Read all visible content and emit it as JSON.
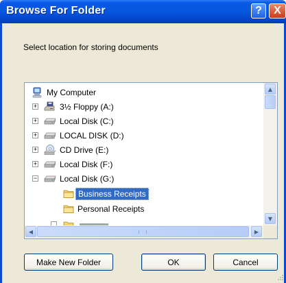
{
  "window": {
    "title": "Browse For Folder",
    "help_glyph": "?",
    "close_glyph": "X"
  },
  "description": "Select location for storing documents",
  "tree": {
    "items": [
      {
        "label": "My Computer",
        "icon": "my-computer-icon",
        "expander": ""
      },
      {
        "label": "3½ Floppy (A:)",
        "icon": "floppy-drive-icon",
        "expander": "+"
      },
      {
        "label": "Local Disk (C:)",
        "icon": "hard-disk-icon",
        "expander": "+"
      },
      {
        "label": "LOCAL DISK (D:)",
        "icon": "hard-disk-icon",
        "expander": "+"
      },
      {
        "label": "CD Drive (E:)",
        "icon": "cd-drive-icon",
        "expander": "+"
      },
      {
        "label": "Local Disk (F:)",
        "icon": "hard-disk-icon",
        "expander": "+"
      },
      {
        "label": "Local Disk (G:)",
        "icon": "hard-disk-icon",
        "expander": "−"
      },
      {
        "label": "Business Receipts",
        "icon": "folder-icon",
        "expander": "",
        "selected": true
      },
      {
        "label": "Personal Receipts",
        "icon": "folder-icon",
        "expander": ""
      }
    ],
    "scroll_arrows": {
      "up": "▲",
      "down": "▼",
      "left": "◀",
      "right": "▶"
    }
  },
  "buttons": {
    "new_folder": "Make New Folder",
    "ok": "OK",
    "cancel": "Cancel"
  },
  "colors": {
    "title_bar": "#0a58e6",
    "selection": "#316ac5",
    "dialog_face": "#ece9d8"
  }
}
